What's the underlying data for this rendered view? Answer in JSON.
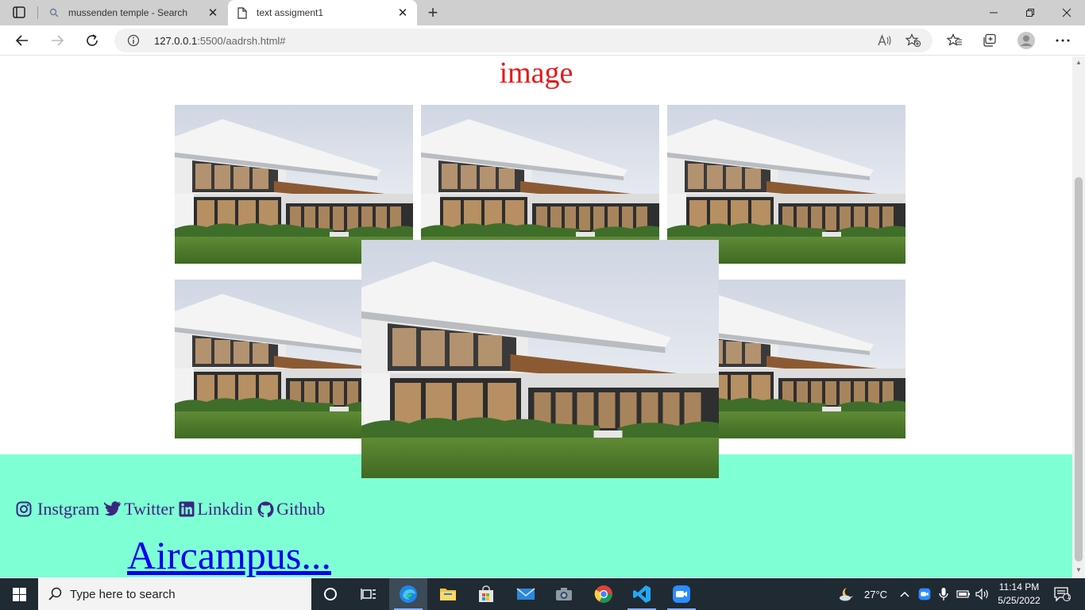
{
  "browser": {
    "tabs": [
      {
        "label": "mussenden temple - Search",
        "active": false
      },
      {
        "label": "text assigment1",
        "active": true
      }
    ],
    "url_host": "127.0.0.1",
    "url_rest": ":5500/aadrsh.html#"
  },
  "page": {
    "heading": "image",
    "social_links": [
      {
        "label": "Instgram",
        "icon": "instagram-icon"
      },
      {
        "label": "Twitter",
        "icon": "twitter-icon"
      },
      {
        "label": "Linkdin",
        "icon": "linkedin-icon"
      },
      {
        "label": "Github",
        "icon": "github-icon"
      }
    ],
    "brand_link": "Aircampus...",
    "colors": {
      "heading": "#e21b1b",
      "footer_bg": "#7fffd4",
      "social_text": "#3a2680",
      "link": "#0000ee"
    }
  },
  "taskbar": {
    "search_placeholder": "Type here to search",
    "weather": "27°C",
    "time": "11:14 PM",
    "date": "5/25/2022",
    "notification_count": "1"
  }
}
